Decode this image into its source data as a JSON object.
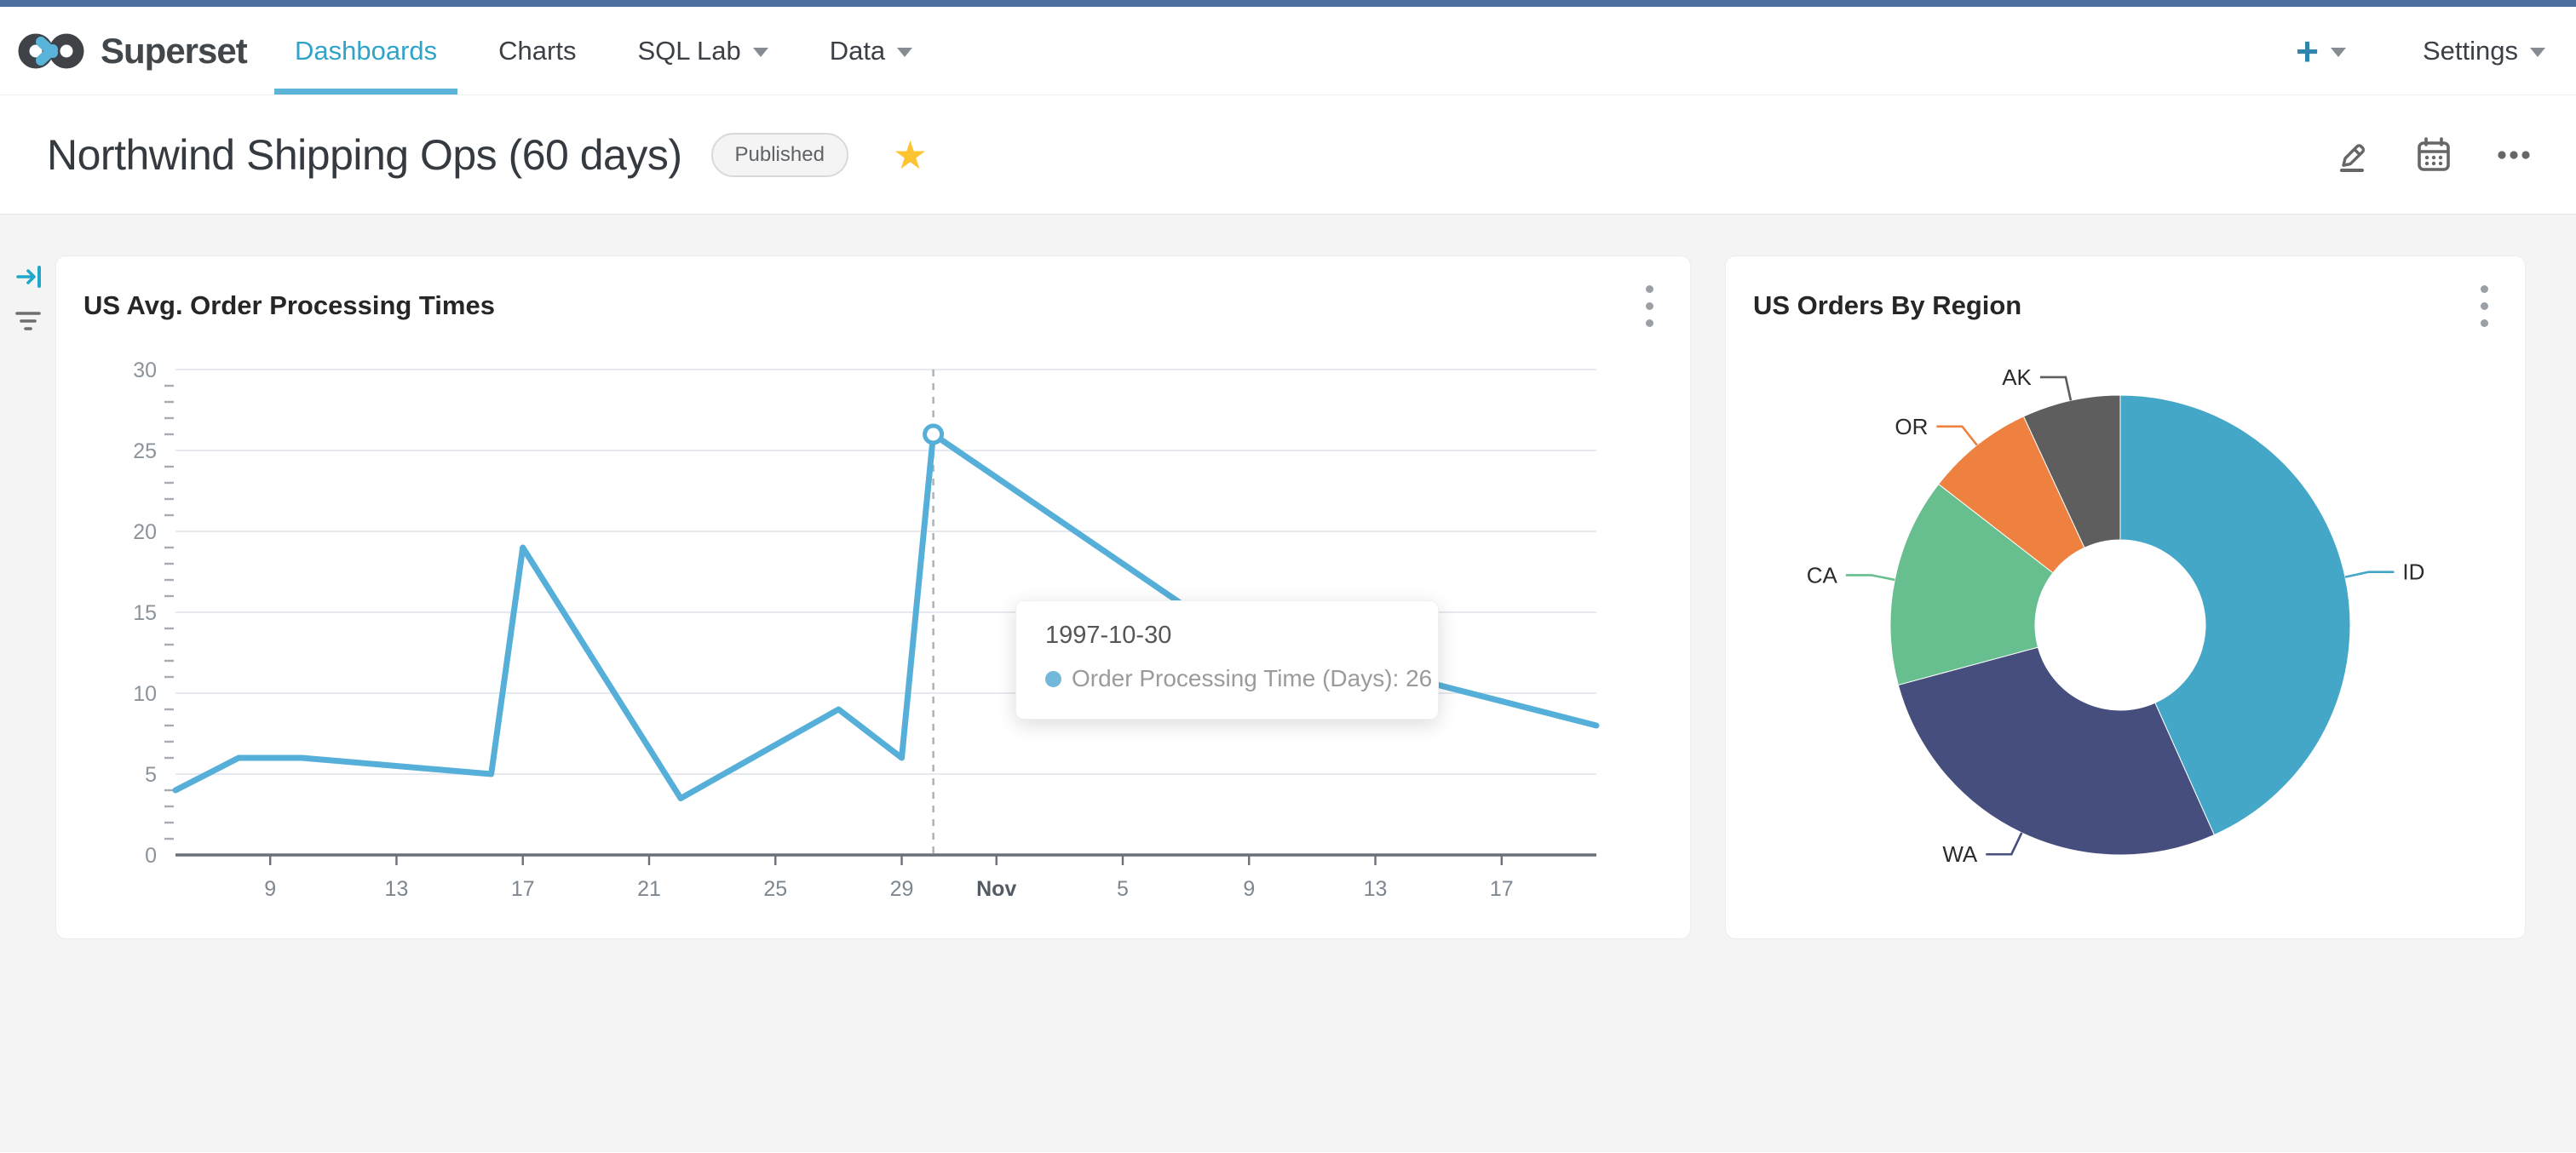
{
  "topbar": {
    "color": "#4C6FA0"
  },
  "navbar": {
    "brand": "Superset",
    "items": [
      {
        "label": "Dashboards",
        "active": true,
        "caret": false
      },
      {
        "label": "Charts",
        "active": false,
        "caret": false
      },
      {
        "label": "SQL Lab",
        "active": false,
        "caret": true
      },
      {
        "label": "Data",
        "active": false,
        "caret": true
      }
    ],
    "plus_label": "+",
    "settings_label": "Settings",
    "accent_color": "#20A7C9"
  },
  "header": {
    "title": "Northwind Shipping Ops (60 days)",
    "badge": "Published",
    "icons": [
      "edit-pencil",
      "calendar",
      "more-ellipsis"
    ],
    "star_color": "#FCC431"
  },
  "filter_rail": {
    "icons": [
      "expand-filter-bar",
      "filter-list"
    ]
  },
  "cards": [
    {
      "title": "US Avg. Order Processing Times"
    },
    {
      "title": "US Orders By Region"
    }
  ],
  "tooltip": {
    "date": "1997-10-30",
    "series": "Order Processing Time (Days)",
    "value": 26,
    "dot_color": "#72b8db"
  },
  "chart_data": [
    {
      "type": "line",
      "title": "US Avg. Order Processing Times",
      "series_name": "Order Processing Time (Days)",
      "color": "#55AFD8",
      "x_start_date": "1997-10-06",
      "x_end_date": "1997-11-20",
      "points": [
        {
          "date": "1997-10-06",
          "day": 0,
          "value": 4
        },
        {
          "date": "1997-10-08",
          "day": 2,
          "value": 6
        },
        {
          "date": "1997-10-10",
          "day": 4,
          "value": 6
        },
        {
          "date": "1997-10-16",
          "day": 10,
          "value": 5
        },
        {
          "date": "1997-10-17",
          "day": 11,
          "value": 19
        },
        {
          "date": "1997-10-22",
          "day": 16,
          "value": 3.5
        },
        {
          "date": "1997-10-27",
          "day": 21,
          "value": 9
        },
        {
          "date": "1997-10-29",
          "day": 23,
          "value": 6
        },
        {
          "date": "1997-10-30",
          "day": 24,
          "value": 26
        },
        {
          "date": "1997-11-08",
          "day": 33,
          "value": 14
        },
        {
          "date": "1997-11-20",
          "day": 45,
          "value": 8
        }
      ],
      "highlight": {
        "date": "1997-10-30",
        "day": 24,
        "value": 26
      },
      "ylim": [
        0,
        30
      ],
      "y_ticks": [
        0,
        5,
        10,
        15,
        20,
        25,
        30
      ],
      "x_ticks": [
        {
          "day": 3,
          "label": "9",
          "emphasis": false
        },
        {
          "day": 7,
          "label": "13",
          "emphasis": false
        },
        {
          "day": 11,
          "label": "17",
          "emphasis": false
        },
        {
          "day": 15,
          "label": "21",
          "emphasis": false
        },
        {
          "day": 19,
          "label": "25",
          "emphasis": false
        },
        {
          "day": 23,
          "label": "29",
          "emphasis": false
        },
        {
          "day": 26,
          "label": "Nov",
          "emphasis": true
        },
        {
          "day": 30,
          "label": "5",
          "emphasis": false
        },
        {
          "day": 34,
          "label": "9",
          "emphasis": false
        },
        {
          "day": 38,
          "label": "13",
          "emphasis": false
        },
        {
          "day": 42,
          "label": "17",
          "emphasis": false
        }
      ],
      "grid": true,
      "legend": "none"
    },
    {
      "type": "pie",
      "title": "US Orders By Region",
      "donut": true,
      "inner_radius_ratio": 0.37,
      "labels": [
        "ID",
        "WA",
        "CA",
        "OR",
        "AK"
      ],
      "values": [
        43.3,
        27.5,
        14.7,
        7.6,
        6.9
      ],
      "colors": [
        "#45A7C8",
        "#454E7C",
        "#67BE8E",
        "#EE8140",
        "#5E5E5E"
      ],
      "label_position": "outside"
    }
  ]
}
